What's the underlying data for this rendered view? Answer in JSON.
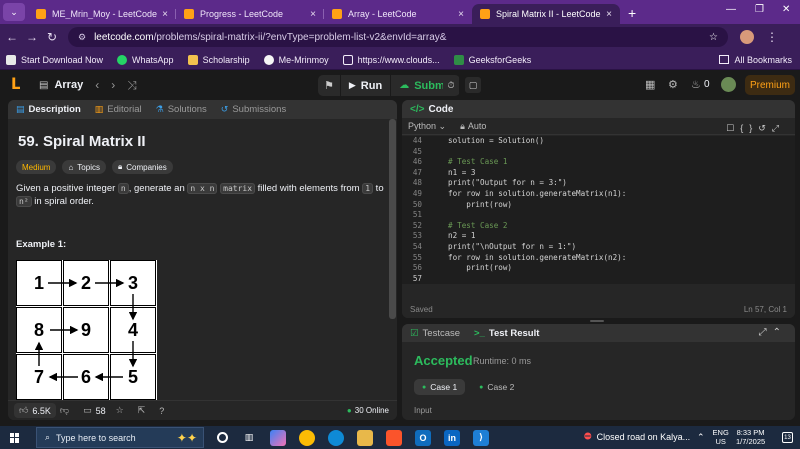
{
  "browser": {
    "tabs": [
      {
        "title": "ME_Mrin_Moy - LeetCode Profi",
        "color": "#ffa116"
      },
      {
        "title": "Progress - LeetCode",
        "color": "#ffa116"
      },
      {
        "title": "Array - LeetCode",
        "color": "#ffa116"
      },
      {
        "title": "Spiral Matrix II - LeetCode",
        "color": "#ffa116"
      }
    ],
    "url_host": "leetcode.com",
    "url_path": "/problems/spiral-matrix-ii/?envType=problem-list-v2&envId=array&",
    "bookmarks": [
      "Start Download Now",
      "WhatsApp",
      "Scholarship",
      "Me-Mrinmoy",
      "https://www.clouds...",
      "GeeksforGeeks"
    ],
    "all_bookmarks": "All Bookmarks"
  },
  "lc_nav": {
    "problem_list": "Array",
    "run_label": "Run",
    "submit_label": "Submit",
    "coins": "0",
    "premium_label": "Premium"
  },
  "left_tabs": {
    "description": "Description",
    "editorial": "Editorial",
    "solutions": "Solutions",
    "submissions": "Submissions"
  },
  "problem": {
    "title": "59. Spiral Matrix II",
    "difficulty": "Medium",
    "topics": "Topics",
    "companies": "Companies",
    "desc_pre": "Given a positive integer ",
    "code_n": "n",
    "desc_mid": ", generate an ",
    "code_nxn": "n x n",
    "code_matrix": "matrix",
    "desc_mid2": " filled with elements from ",
    "code_1": "1",
    "desc_to": " to ",
    "code_n2": "n²",
    "desc_post": " in spiral order.",
    "example_label": "Example 1:",
    "grid": [
      [
        "1",
        "2",
        "3"
      ],
      [
        "8",
        "9",
        "4"
      ],
      [
        "7",
        "6",
        "5"
      ]
    ]
  },
  "left_footer": {
    "likes": "6.5K",
    "comments": "58",
    "online": "30 Online"
  },
  "code_panel": {
    "title": "Code",
    "language": "Python",
    "mode": "Auto",
    "lines": [
      {
        "n": "44",
        "t": "solution = Solution()"
      },
      {
        "n": "45",
        "t": ""
      },
      {
        "n": "46",
        "t": "# Test Case 1"
      },
      {
        "n": "47",
        "t": "n1 = 3"
      },
      {
        "n": "48",
        "t": "print(\"Output for n = 3:\")"
      },
      {
        "n": "49",
        "t": "for row in solution.generateMatrix(n1):"
      },
      {
        "n": "50",
        "t": "    print(row)"
      },
      {
        "n": "51",
        "t": ""
      },
      {
        "n": "52",
        "t": "# Test Case 2"
      },
      {
        "n": "53",
        "t": "n2 = 1"
      },
      {
        "n": "54",
        "t": "print(\"\\nOutput for n = 1:\")"
      },
      {
        "n": "55",
        "t": "for row in solution.generateMatrix(n2):"
      },
      {
        "n": "56",
        "t": "    print(row)"
      },
      {
        "n": "57",
        "t": ""
      }
    ],
    "status": "Saved",
    "cursor": "Ln 57, Col 1"
  },
  "test_panel": {
    "testcase_tab": "Testcase",
    "result_tab": "Test Result",
    "verdict": "Accepted",
    "runtime": "Runtime: 0 ms",
    "cases": [
      "Case 1",
      "Case 2"
    ],
    "input_label": "Input"
  },
  "taskbar": {
    "search_placeholder": "Type here to search",
    "alert": "Closed road on Kalya...",
    "lang": "ENG",
    "region": "US",
    "time": "8:33 PM",
    "date": "1/7/2025",
    "notifications": "13"
  }
}
